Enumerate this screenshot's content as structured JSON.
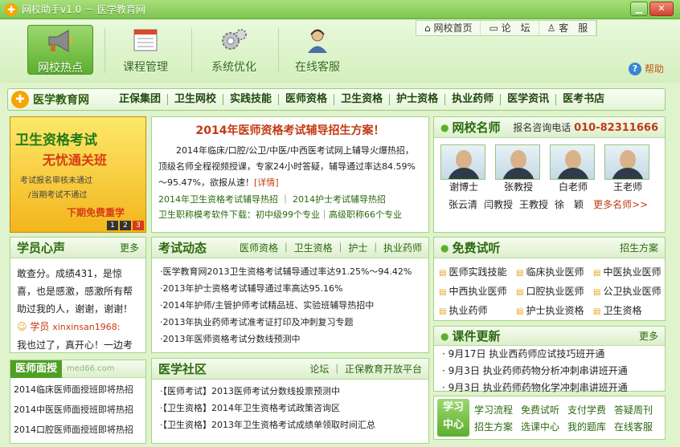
{
  "window": {
    "title": "网校助手v1.0 － 医学教育网",
    "btn_min": "▁",
    "btn_max": "□",
    "btn_close": "✕"
  },
  "nav": [
    {
      "label": "网校热点"
    },
    {
      "label": "课程管理"
    },
    {
      "label": "系统优化"
    },
    {
      "label": "在线客服"
    }
  ],
  "toplinks": [
    "网校首页",
    "论　坛",
    "客　服"
  ],
  "help": "帮助",
  "catbar": {
    "brand": "医学教育网",
    "items": [
      "正保集团",
      "卫生网校",
      "实践技能",
      "医师资格",
      "卫生资格",
      "护士资格",
      "执业药师",
      "医学资讯",
      "医考书店"
    ]
  },
  "banner": {
    "line1": "卫生资格考试",
    "line2": "无忧通关班",
    "line3": "考试报名审核未通过",
    "line4": "/当期考试不通过",
    "line5": "下期免费重学",
    "pages": [
      "1",
      "2",
      "3"
    ]
  },
  "headline": {
    "title": "2014年医师资格考试辅导招生方案！",
    "body": "2014年临床/口腔/公卫/中医/中西医考试网上辅导火爆热招，顶级名师全程视频授课，专家24小时答疑，辅导通过率达84.59%～95.47%，欲报从速！",
    "detail": "[详情]",
    "link1": "2014年卫生资格考试辅导热招",
    "link2": "2014护士考试辅导热招",
    "link3": "卫生职称模考软件下载：初中级99个专业｜高级职称66个专业"
  },
  "teachers": {
    "title": "网校名师",
    "phone_label": "报名咨询电话",
    "phone": "010-82311666",
    "list": [
      "谢博士",
      "张教授",
      "白老师",
      "王老师"
    ],
    "row2": [
      "张云清",
      "闫教授",
      "王教授",
      "徐　颖"
    ],
    "more": "更多名师>>"
  },
  "voice": {
    "title": "学员心声",
    "more": "更多",
    "text": "敢查分。成绩431，是惊喜，也是感激，感激所有帮助过我的人，谢谢，谢谢！",
    "user": "学员",
    "user_id": "xinxinsan1968:",
    "text2": "我也过了，真开心！一边考"
  },
  "exam": {
    "title": "考试动态",
    "links": [
      "医师资格",
      "卫生资格",
      "护士",
      "执业药师"
    ],
    "items": [
      "·医学教育网2013卫生资格考试辅导通过率达91.25%～94.42%",
      "·2013年护士资格考试辅导通过率高达95.16%",
      "·2014年护师/主管护师考试精品班、实验班辅导热招中",
      "·2013年执业药师考试准考证打印及冲刺复习专题",
      "·2013年医师资格考试分数线预测中"
    ]
  },
  "trial": {
    "title": "免费试听",
    "more": "招生方案",
    "items": [
      "医师实践技能",
      "临床执业医师",
      "中医执业医师",
      "中西执业医师",
      "口腔执业医师",
      "公卫执业医师",
      "执业药师",
      "护士执业资格",
      "卫生资格"
    ]
  },
  "course": {
    "title": "课件更新",
    "more": "更多",
    "items": [
      "· 9月17日 执业西药师应试技巧班开通",
      "· 9月3日  执业药师药物分析冲刺串讲班开通",
      "· 9月3日  执业药师药物化学冲刺串讲班开通"
    ]
  },
  "community": {
    "title": "医学社区",
    "links": [
      "论坛",
      "正保教育开放平台"
    ],
    "items": [
      "·【医师考试】2013医师考试分数线投票预测中",
      "·【卫生资格】2014年卫生资格考试政策咨询区",
      "·【卫生资格】2013年卫生资格考试成绩单领取时间汇总"
    ]
  },
  "mianshou": {
    "tag": "医师面授",
    "watermark": "med66.com",
    "items": [
      "2014临床医师面授班即将热招",
      "2014中医医师面授班即将热招",
      "2014口腔医师面授班即将热招"
    ]
  },
  "study": {
    "tag1": "学习",
    "tag2": "中心",
    "links": [
      "学习流程",
      "免费试听",
      "支付学费",
      "答疑周刊",
      "招生方案",
      "选课中心",
      "我的题库",
      "在线客服"
    ]
  }
}
